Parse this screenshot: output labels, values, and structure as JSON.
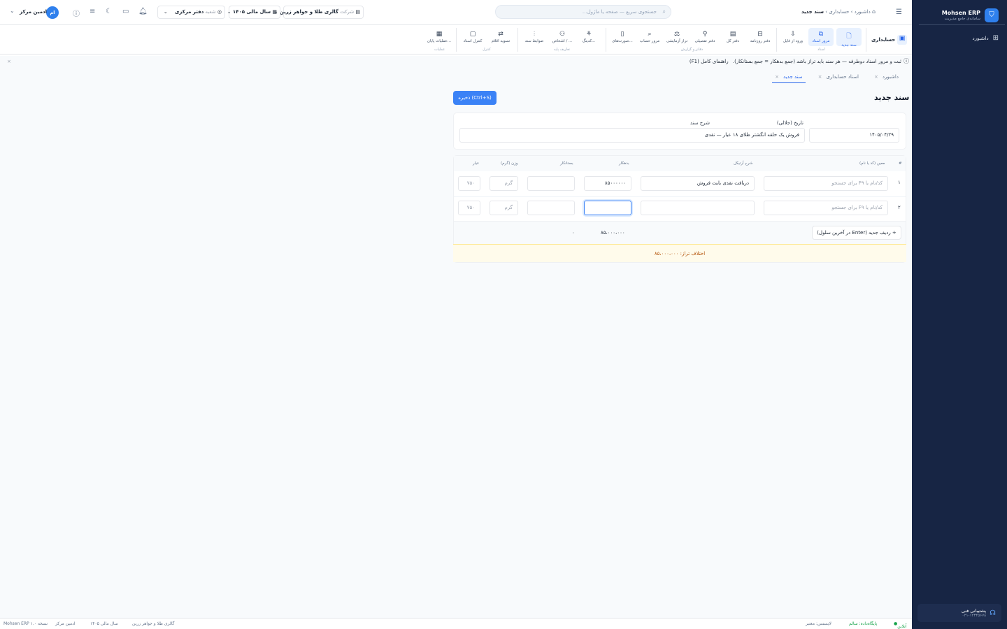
{
  "sidebar": {
    "brand_name": "Mohsen ERP",
    "brand_sub": "سامانه‌ی جامع مدیریت",
    "items": [
      {
        "label": "داشبورد",
        "icon": "grid-icon"
      }
    ],
    "support_title": "پشتیبانی فنی",
    "support_phone": "۰۲۱-۱۲۳۴۵۶۷۸"
  },
  "topbar": {
    "breadcrumb": [
      "داشبورد",
      "حسابداری",
      "سند جدید"
    ],
    "search_placeholder": "جستجوی سریع — صفحه یا ماژول...",
    "company_label": "شرکت",
    "company_value": "گالری طلا و جواهر زرین",
    "year_value": "سال مالی ۱۴۰۵",
    "branch_label": "شعبه",
    "branch_value": "دفتر مرکزی",
    "user_name": "ادمین مرکز",
    "user_initials": "ام"
  },
  "toolbar": {
    "module": "حسابداری",
    "buttons": [
      {
        "label": "سند جدید",
        "icon": "new-doc-icon"
      },
      {
        "label": "مرور اسناد",
        "icon": "docs-icon"
      },
      {
        "label": "ورود از فایل",
        "icon": "import-icon"
      },
      {
        "label": "دفتر روزنامه",
        "icon": "book-icon"
      },
      {
        "label": "دفتر کل",
        "icon": "ledger-icon"
      },
      {
        "label": "دفتر تفصیلی",
        "icon": "detail-icon"
      },
      {
        "label": "تراز آزمایشی",
        "icon": "scale-icon"
      },
      {
        "label": "مرور حساب",
        "icon": "search-icon"
      },
      {
        "label": "صورت‌های...",
        "icon": "statement-icon"
      },
      {
        "label": "کدینگ...",
        "icon": "coding-icon"
      },
      {
        "label": "اشخاص / ...",
        "icon": "people-icon"
      },
      {
        "label": "ضوابط سند",
        "icon": "rules-icon"
      },
      {
        "label": "تسویه اقلام",
        "icon": "settle-icon"
      },
      {
        "label": "کنترل اسناد",
        "icon": "control-icon"
      },
      {
        "label": "عملیات پایان...",
        "icon": "close-year-icon"
      }
    ],
    "groups": [
      "اسناد",
      "دفاتر و گزارش",
      "تعاریف پایه",
      "کنترل",
      "عملیات"
    ]
  },
  "banner": {
    "text": "ثبت و مرور اسناد دوطرفه — هر سند باید تراز باشد (جمع بدهکار = جمع بستانکار).",
    "help": "راهنمای کامل (F1)"
  },
  "tabs": [
    {
      "label": "داشبورد"
    },
    {
      "label": "اسناد حسابداری"
    },
    {
      "label": "سند جدید"
    }
  ],
  "page": {
    "title": "سند جدید",
    "save_label": "ذخیره (Ctrl+S)",
    "date_label": "تاریخ (جلالی)",
    "date_value": "۱۴۰۵/۰۴/۲۹",
    "desc_label": "شرح سند",
    "desc_value": "فروش یک حلقه انگشتر طلای ۱۸ عیار — نقدی"
  },
  "grid": {
    "headers": {
      "num": "#",
      "account": "معین (کد یا نام)",
      "desc": "شرح آرتیکل",
      "debit": "بدهکار",
      "credit": "بستانکار",
      "weight": "وزن (گرم)",
      "karat": "عیار"
    },
    "account_placeholder": "کد/نام یا F۹ برای جستجو",
    "weight_placeholder": "گرم",
    "karat_placeholder": "۷۵۰",
    "rows": [
      {
        "num": "۱",
        "desc": "دریافت نقدی بابت فروش",
        "debit": "۸۵۰۰۰۰۰۰",
        "credit": ""
      },
      {
        "num": "۲",
        "desc": "",
        "debit": "",
        "credit": ""
      }
    ],
    "add_row": "+ ردیف جدید (Enter در آخرین سلول)",
    "total_debit": "۸۵،۰۰۰،۰۰۰",
    "total_credit": "۰",
    "diff_text": "اختلاف تراز: ۸۵،۰۰۰،۰۰۰"
  },
  "status": {
    "online": "آنلاین",
    "db": "پایگاه‌داده: سالم",
    "license": "لایسنس: معتبر",
    "company": "گالری طلا و جواهر زرین",
    "year": "سال مالی ۱۴۰۵",
    "user": "ادمین مرکز",
    "version": "Mohsen ERP نسخه ۱.۰"
  },
  "colors": {
    "accent": "#2f80ed",
    "sidebar": "#172544",
    "warning_bg": "#fffbeb",
    "warning_text": "#b45309"
  }
}
